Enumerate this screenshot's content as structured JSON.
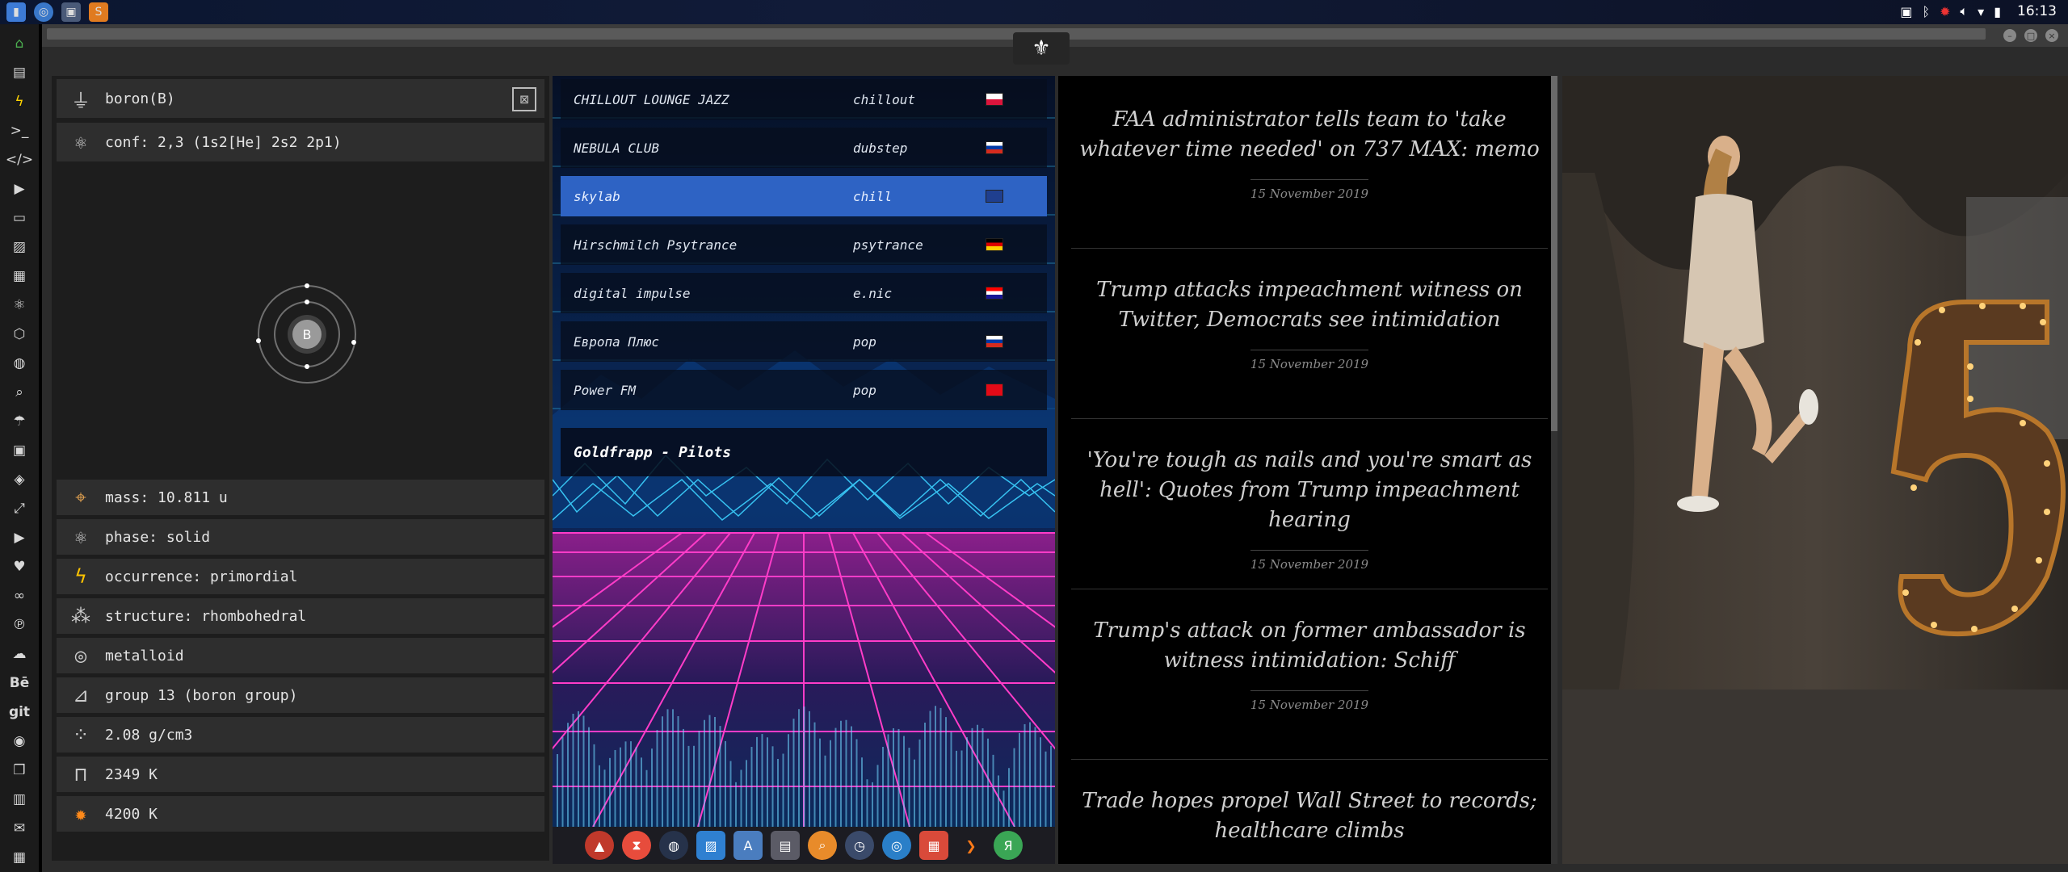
{
  "system": {
    "clock": "16:13"
  },
  "element": {
    "header": "boron(B)",
    "configuration": "conf: 2,3 (1s2[He] 2s2 2p1)",
    "atom_symbol": "B",
    "properties": [
      {
        "icon": "pin-icon",
        "label": "mass: 10.811 u"
      },
      {
        "icon": "atom-icon",
        "label": "phase: solid"
      },
      {
        "icon": "lightning-icon",
        "label": "occurrence: primordial"
      },
      {
        "icon": "molecule-icon",
        "label": "structure: rhombohedral"
      },
      {
        "icon": "orbit-icon",
        "label": "metalloid"
      },
      {
        "icon": "group-icon",
        "label": "group 13 (boron group)"
      },
      {
        "icon": "particles-icon",
        "label": "2.08 g/cm3"
      },
      {
        "icon": "thermometer-icon",
        "label": "2349 K"
      },
      {
        "icon": "fire-icon",
        "label": "4200 K"
      }
    ]
  },
  "radio": {
    "stations": [
      {
        "name": "CHILLOUT LOUNGE JAZZ",
        "genre": "chillout",
        "flag": "pl"
      },
      {
        "name": "NEBULA CLUB",
        "genre": "dubstep",
        "flag": "ru"
      },
      {
        "name": "skylab",
        "genre": "chill",
        "flag": "gb",
        "selected": true
      },
      {
        "name": "Hirschmilch Psytrance",
        "genre": "psytrance",
        "flag": "de"
      },
      {
        "name": "digital impulse",
        "genre": "e.nic",
        "flag": "hr"
      },
      {
        "name": "Европа Плюс",
        "genre": "pop",
        "flag": "ru"
      },
      {
        "name": "Power FM",
        "genre": "pop",
        "flag": "tr"
      }
    ],
    "now_playing": "Goldfrapp - Pilots"
  },
  "news": {
    "articles": [
      {
        "title": "FAA administrator tells team to 'take whatever time needed' on 737 MAX: memo",
        "date": "15 November 2019"
      },
      {
        "title": "Trump attacks impeachment witness on Twitter, Democrats see intimidation",
        "date": "15 November 2019"
      },
      {
        "title": "'You're tough as nails and you're smart as hell': Quotes from Trump impeachment hearing",
        "date": "15 November 2019"
      },
      {
        "title": "Trump's attack on former ambassador is witness intimidation: Schiff",
        "date": "15 November 2019"
      },
      {
        "title": "Trade hopes propel Wall Street to records; healthcare climbs",
        "date": ""
      }
    ]
  },
  "colors": {
    "selected_station": "#2e63c4",
    "grid_magenta": "#ff3cc8",
    "grid_cyan": "#3cd2ff"
  }
}
